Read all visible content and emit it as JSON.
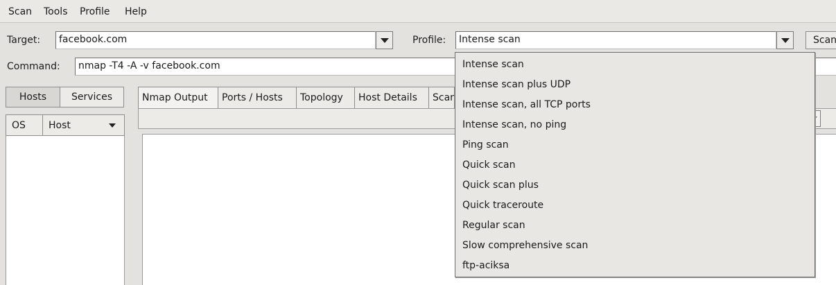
{
  "menubar": {
    "scan": "Scan",
    "tools": "Tools",
    "profile": "Profile",
    "help": "Help"
  },
  "target": {
    "label": "Target:",
    "value": "facebook.com"
  },
  "profile": {
    "label": "Profile:",
    "value": "Intense scan"
  },
  "scan_button": "Scan",
  "command": {
    "label": "Command:",
    "value": "nmap -T4 -A -v facebook.com"
  },
  "left_panel": {
    "hosts_tab": "Hosts",
    "services_tab": "Services",
    "os_column": "OS",
    "host_column": "Host"
  },
  "notebook_tabs": [
    "Nmap Output",
    "Ports / Hosts",
    "Topology",
    "Host Details",
    "Scan"
  ],
  "profile_options": [
    "Intense scan",
    "Intense scan plus UDP",
    "Intense scan, all TCP ports",
    "Intense scan, no ping",
    "Ping scan",
    "Quick scan",
    "Quick scan plus",
    "Quick traceroute",
    "Regular scan",
    "Slow comprehensive scan",
    "ftp-aciksa"
  ]
}
